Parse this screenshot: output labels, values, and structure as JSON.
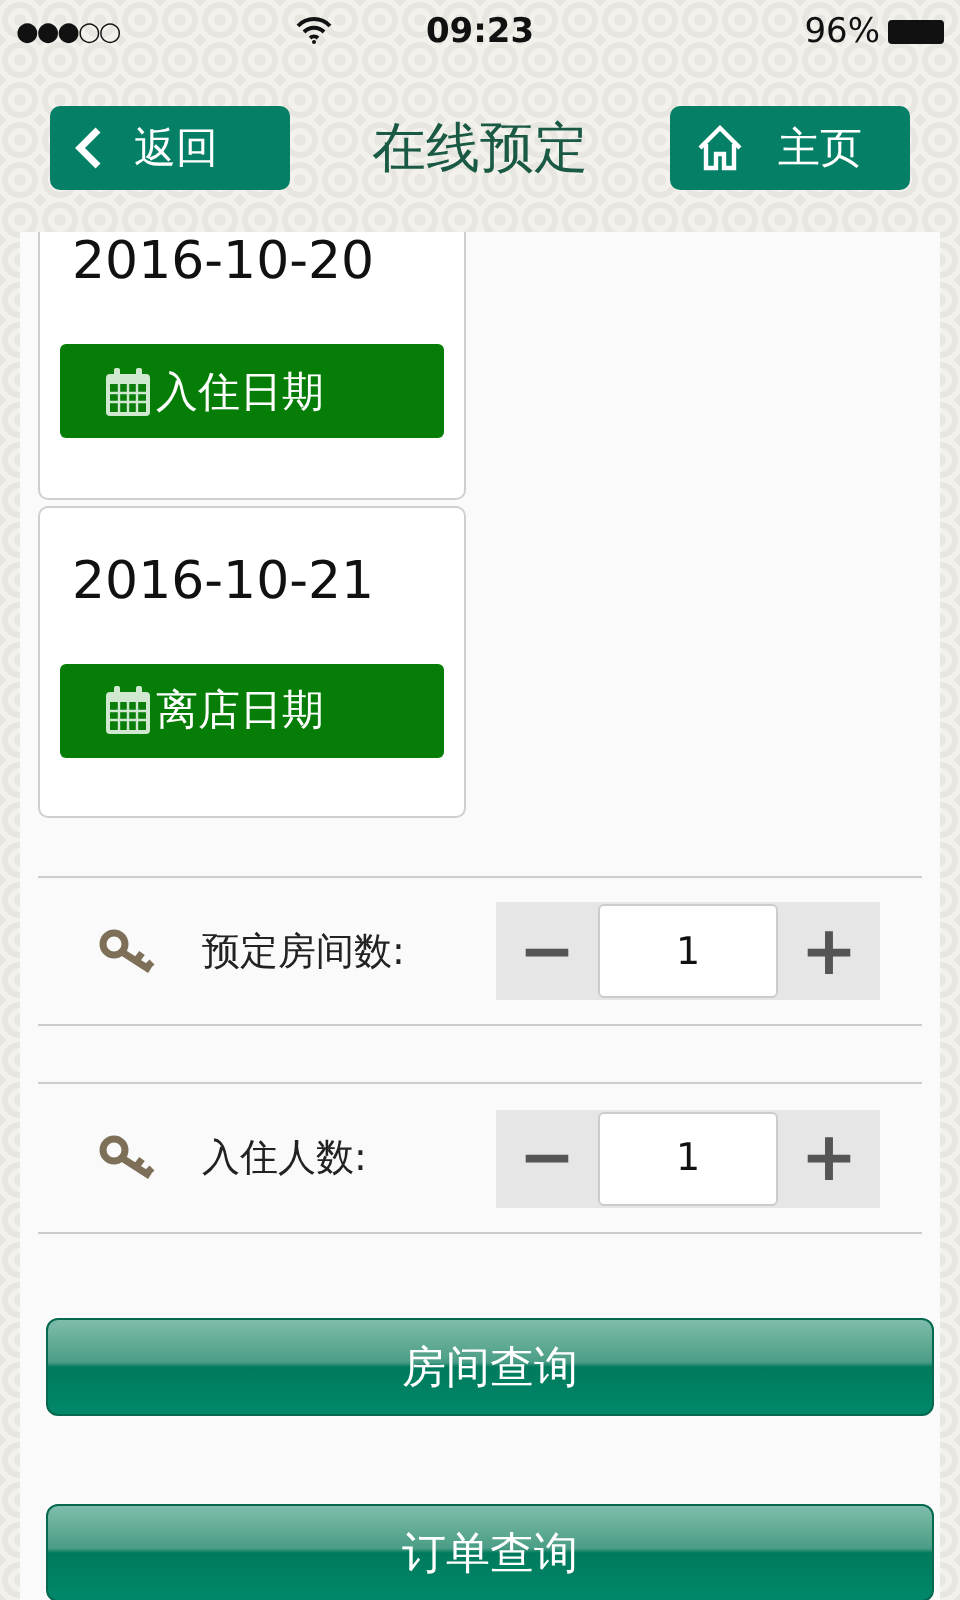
{
  "status_bar": {
    "signal_dots": "●●●○○",
    "time": "09:23",
    "battery": "96%"
  },
  "header": {
    "back": "返回",
    "title": "在线预定",
    "home": "主页"
  },
  "dates": [
    {
      "date": "2016-10-20",
      "button": "入住日期"
    },
    {
      "date": "2016-10-21",
      "button": "离店日期"
    }
  ],
  "counters": [
    {
      "label": "预定房间数:",
      "minus": "−",
      "value": "1",
      "plus": "+"
    },
    {
      "label": "入住人数:",
      "minus": "−",
      "value": "1",
      "plus": "+"
    }
  ],
  "actions": [
    "房间查询",
    "订单查询"
  ]
}
